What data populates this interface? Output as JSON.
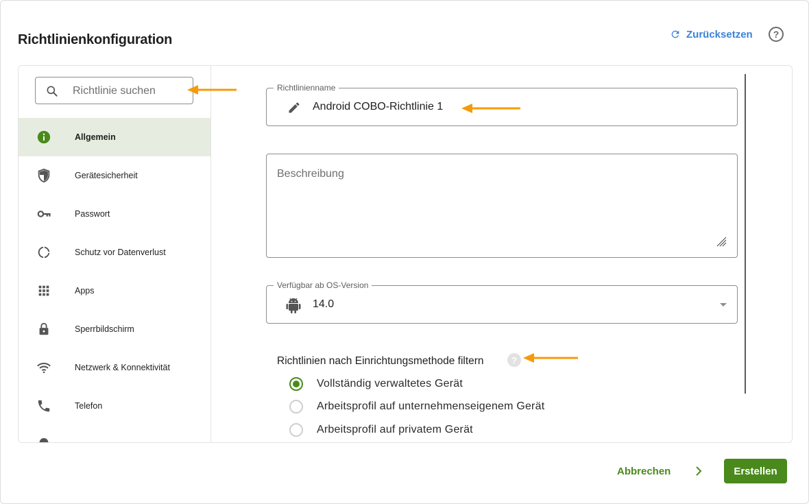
{
  "header": {
    "title": "Richtlinienkonfiguration",
    "reset_label": "Zurücksetzen",
    "help_glyph": "?"
  },
  "sidebar": {
    "search_placeholder": "Richtlinie suchen",
    "items": [
      {
        "label": "Allgemein",
        "icon": "info-icon",
        "active": true
      },
      {
        "label": "Gerätesicherheit",
        "icon": "shield-icon",
        "active": false
      },
      {
        "label": "Passwort",
        "icon": "key-icon",
        "active": false
      },
      {
        "label": "Schutz vor Datenverlust",
        "icon": "data-loss-icon",
        "active": false
      },
      {
        "label": "Apps",
        "icon": "apps-grid-icon",
        "active": false
      },
      {
        "label": "Sperrbildschirm",
        "icon": "lock-icon",
        "active": false
      },
      {
        "label": "Netzwerk & Konnektivität",
        "icon": "wifi-icon",
        "active": false
      },
      {
        "label": "Telefon",
        "icon": "phone-icon",
        "active": false
      }
    ]
  },
  "form": {
    "name_label": "Richtlinienname",
    "name_value": "Android COBO-Richtlinie 1",
    "description_placeholder": "Beschreibung",
    "os_label": "Verfügbar ab OS-Version",
    "os_value": "14.0",
    "filter_title": "Richtlinien nach Einrichtungsmethode filtern",
    "filter_help_glyph": "?",
    "options": [
      {
        "label": "Vollständig verwaltetes Gerät",
        "checked": true
      },
      {
        "label": "Arbeitsprofil auf unternehmenseigenem Gerät",
        "checked": false
      },
      {
        "label": "Arbeitsprofil auf privatem Gerät",
        "checked": false
      }
    ]
  },
  "footer": {
    "cancel_label": "Abbrechen",
    "create_label": "Erstellen"
  },
  "colors": {
    "accent_green": "#4a8a1c",
    "link_blue": "#3b82d9",
    "annotation_orange": "#f59b0b",
    "active_bg": "#e6ede0"
  }
}
